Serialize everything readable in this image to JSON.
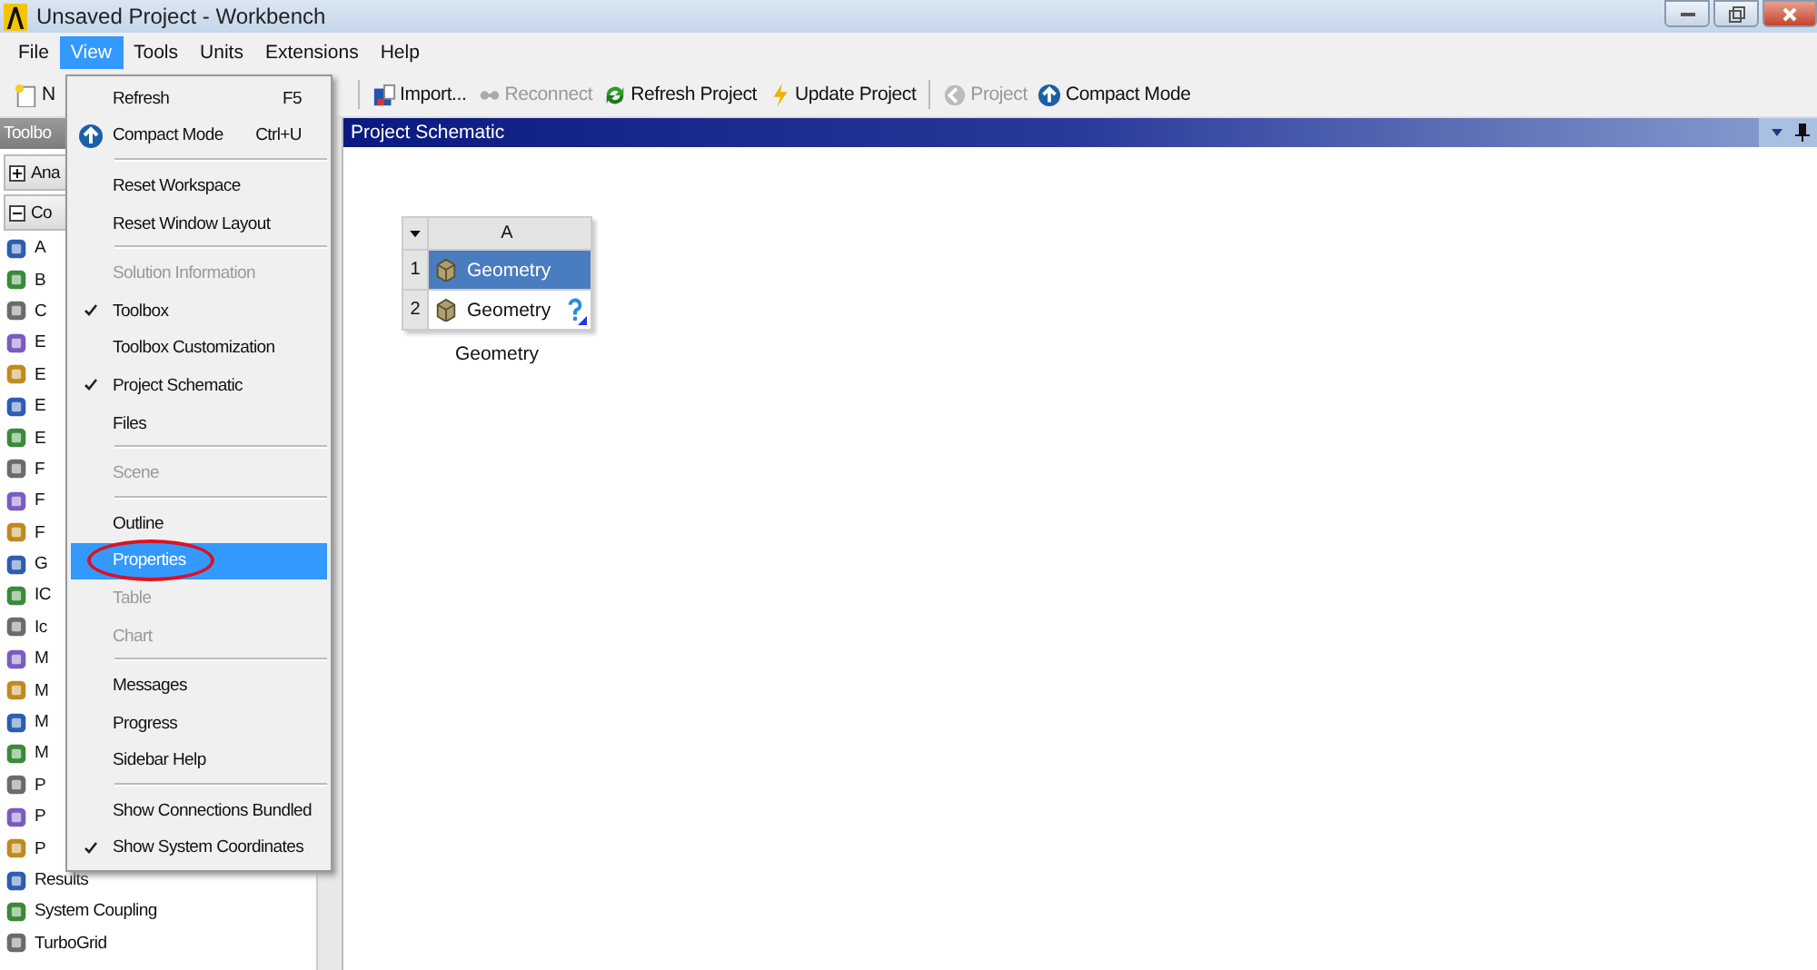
{
  "window": {
    "title": "Unsaved Project - Workbench"
  },
  "menu_bar": [
    {
      "label": "File",
      "selected": false
    },
    {
      "label": "View",
      "selected": true
    },
    {
      "label": "Tools",
      "selected": false
    },
    {
      "label": "Units",
      "selected": false
    },
    {
      "label": "Extensions",
      "selected": false
    },
    {
      "label": "Help",
      "selected": false
    }
  ],
  "toolbar": {
    "leading_text": "N",
    "buttons": [
      {
        "label": "Import...",
        "disabled": false
      },
      {
        "label": "Reconnect",
        "disabled": true
      },
      {
        "label": "Refresh Project",
        "disabled": false
      },
      {
        "label": "Update Project",
        "disabled": false
      },
      {
        "label": "Project",
        "disabled": true
      },
      {
        "label": "Compact Mode",
        "disabled": false
      }
    ]
  },
  "toolbox": {
    "title": "Toolbo",
    "groups": [
      {
        "label": "Ana",
        "expanded": false
      },
      {
        "label": "Co",
        "expanded": true
      }
    ],
    "items": [
      "A",
      "B",
      "C",
      "E",
      "E",
      "E",
      "E",
      "F",
      "F",
      "F",
      "G",
      "IC",
      "Ic",
      "M",
      "M",
      "M",
      "M",
      "P",
      "P",
      "P",
      "Results",
      "System Coupling",
      "TurboGrid"
    ]
  },
  "view_menu": [
    {
      "kind": "item",
      "label": "Refresh",
      "shortcut": "F5",
      "checked": false,
      "disabled": false,
      "selected": false
    },
    {
      "kind": "item",
      "label": "Compact Mode",
      "shortcut": "Ctrl+U",
      "icon": true,
      "checked": false,
      "disabled": false,
      "selected": false
    },
    {
      "kind": "separator"
    },
    {
      "kind": "item",
      "label": "Reset Workspace",
      "checked": false,
      "disabled": false,
      "selected": false
    },
    {
      "kind": "item",
      "label": "Reset Window Layout",
      "checked": false,
      "disabled": false,
      "selected": false
    },
    {
      "kind": "separator"
    },
    {
      "kind": "item",
      "label": "Solution Information",
      "checked": false,
      "disabled": true,
      "selected": false
    },
    {
      "kind": "item",
      "label": "Toolbox",
      "checked": true,
      "disabled": false,
      "selected": false
    },
    {
      "kind": "item",
      "label": "Toolbox Customization",
      "checked": false,
      "disabled": false,
      "selected": false
    },
    {
      "kind": "item",
      "label": "Project Schematic",
      "checked": true,
      "disabled": false,
      "selected": false
    },
    {
      "kind": "item",
      "label": "Files",
      "checked": false,
      "disabled": false,
      "selected": false
    },
    {
      "kind": "separator"
    },
    {
      "kind": "item",
      "label": "Scene",
      "checked": false,
      "disabled": true,
      "selected": false
    },
    {
      "kind": "separator"
    },
    {
      "kind": "item",
      "label": "Outline",
      "checked": false,
      "disabled": false,
      "selected": false
    },
    {
      "kind": "item",
      "label": "Properties",
      "checked": false,
      "disabled": false,
      "selected": true,
      "circled": true
    },
    {
      "kind": "item",
      "label": "Table",
      "checked": false,
      "disabled": true,
      "selected": false
    },
    {
      "kind": "item",
      "label": "Chart",
      "checked": false,
      "disabled": true,
      "selected": false
    },
    {
      "kind": "separator"
    },
    {
      "kind": "item",
      "label": "Messages",
      "checked": false,
      "disabled": false,
      "selected": false
    },
    {
      "kind": "item",
      "label": "Progress",
      "checked": false,
      "disabled": false,
      "selected": false
    },
    {
      "kind": "item",
      "label": "Sidebar Help",
      "checked": false,
      "disabled": false,
      "selected": false
    },
    {
      "kind": "separator"
    },
    {
      "kind": "item",
      "label": "Show Connections Bundled",
      "checked": false,
      "disabled": false,
      "selected": false
    },
    {
      "kind": "item",
      "label": "Show System Coordinates",
      "checked": true,
      "disabled": false,
      "selected": false
    }
  ],
  "schematic": {
    "title": "Project Schematic",
    "system": {
      "column": "A",
      "caption": "Geometry",
      "rows": [
        {
          "number": "1",
          "label": "Geometry",
          "selected": true,
          "needs_input": false
        },
        {
          "number": "2",
          "label": "Geometry",
          "selected": false,
          "needs_input": true
        }
      ]
    }
  }
}
